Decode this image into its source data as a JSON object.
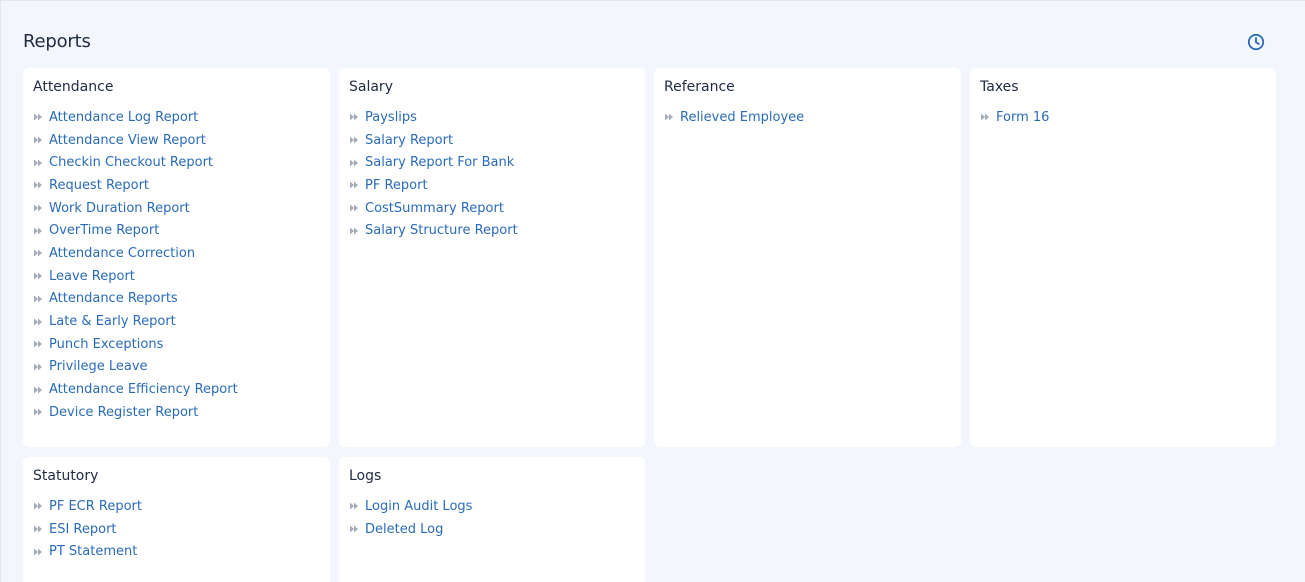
{
  "page": {
    "title": "Reports",
    "history_icon": "clock-icon"
  },
  "cards": [
    {
      "title": "Attendance",
      "items": [
        "Attendance Log Report",
        "Attendance View Report",
        "Checkin Checkout Report",
        "Request Report",
        "Work Duration Report",
        "OverTime Report",
        "Attendance Correction",
        "Leave Report",
        "Attendance Reports",
        "Late & Early Report",
        "Punch Exceptions",
        "Privilege Leave",
        "Attendance Efficiency Report",
        "Device Register Report"
      ]
    },
    {
      "title": "Salary",
      "items": [
        "Payslips",
        "Salary Report",
        "Salary Report For Bank",
        "PF Report",
        "CostSummary Report",
        "Salary Structure Report"
      ]
    },
    {
      "title": "Referance",
      "items": [
        "Relieved Employee"
      ]
    },
    {
      "title": "Taxes",
      "items": [
        "Form 16"
      ]
    },
    {
      "title": "Statutory",
      "items": [
        "PF ECR Report",
        "ESI Report",
        "PT Statement"
      ]
    },
    {
      "title": "Logs",
      "items": [
        "Login Audit Logs",
        "Deleted Log"
      ]
    }
  ],
  "colors": {
    "link": "#2a6bb8",
    "heading": "#1f2a44",
    "background": "#f3f6fc",
    "card": "#ffffff",
    "chevron": "#9aa3b2"
  }
}
